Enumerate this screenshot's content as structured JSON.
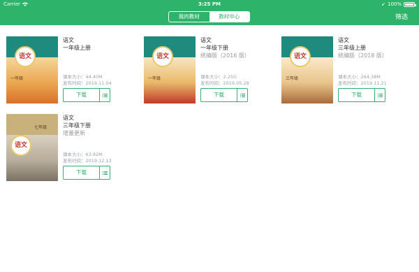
{
  "status": {
    "carrier": "Carrier",
    "time": "3:25 PM",
    "battery": "100%"
  },
  "tabs": {
    "my": "我的教材",
    "center": "教材中心"
  },
  "filter": "筛选",
  "books": [
    {
      "subject": "语文",
      "volume": "一年级上册",
      "edition": "",
      "size_label": "课本大小：",
      "size": "44.40M",
      "date_label": "发布时间：",
      "date": "2019.11.04",
      "download": "下载",
      "grade": "一年级"
    },
    {
      "subject": "语文",
      "volume": "一年级下册",
      "edition": "统编版（2016 版）",
      "size_label": "课本大小：",
      "size": "2.25G",
      "date_label": "发布时间：",
      "date": "2019.05.28",
      "download": "下载",
      "grade": "一年级"
    },
    {
      "subject": "语文",
      "volume": "三年级上册",
      "edition": "统编版（2018 版）",
      "size_label": "课本大小：",
      "size": "264.38M",
      "date_label": "发布时间：",
      "date": "2019.11.21",
      "download": "下载",
      "grade": "三年级"
    },
    {
      "subject": "语文",
      "volume": "三年级下册",
      "edition": "增量更新",
      "size_label": "课本大小：",
      "size": "63.82M",
      "date_label": "发布时间：",
      "date": "2019.12.13",
      "download": "下载",
      "grade": "七年级"
    }
  ],
  "colors": {
    "accent": "#2db36a"
  }
}
